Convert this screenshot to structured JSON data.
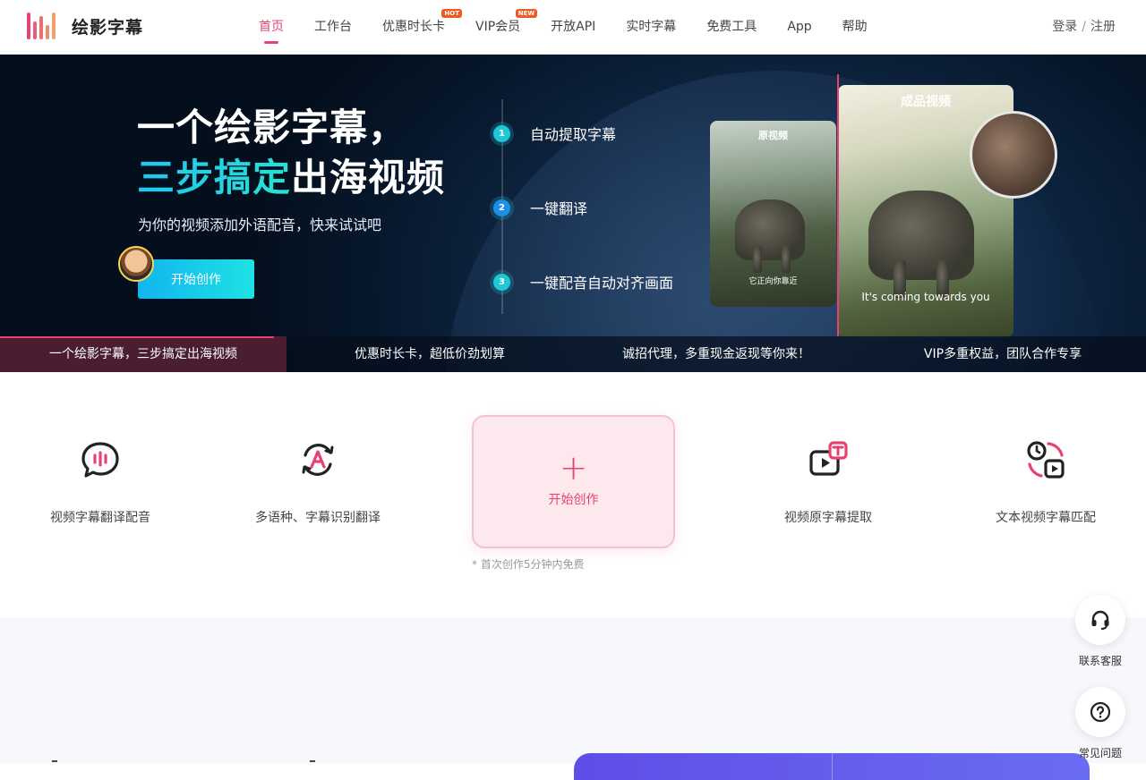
{
  "header": {
    "logo_text": "绘影字幕",
    "nav": [
      {
        "label": "首页",
        "active": true,
        "badge": ""
      },
      {
        "label": "工作台",
        "active": false,
        "badge": ""
      },
      {
        "label": "优惠时长卡",
        "active": false,
        "badge": "HOT"
      },
      {
        "label": "VIP会员",
        "active": false,
        "badge": "NEW"
      },
      {
        "label": "开放API",
        "active": false,
        "badge": ""
      },
      {
        "label": "实时字幕",
        "active": false,
        "badge": ""
      },
      {
        "label": "免费工具",
        "active": false,
        "badge": ""
      },
      {
        "label": "App",
        "active": false,
        "badge": ""
      },
      {
        "label": "帮助",
        "active": false,
        "badge": ""
      }
    ],
    "login": "登录",
    "login_sep": "/",
    "register": "注册"
  },
  "hero": {
    "title_line1": "一个绘影字幕，",
    "title_line2_highlight": "三步搞定",
    "title_line2_rest": "出海视频",
    "subtitle": "为你的视频添加外语配音，快来试试吧",
    "cta": "开始创作",
    "steps": [
      {
        "num": "1",
        "label": "自动提取字幕",
        "color": "#1ec8d6"
      },
      {
        "num": "2",
        "label": "一键翻译",
        "color": "#1e8ee8"
      },
      {
        "num": "3",
        "label": "一键配音自动对齐画面",
        "color": "#1ec8d6"
      }
    ],
    "original_card": {
      "title": "原视频",
      "caption": "它正向你靠近"
    },
    "final_card": {
      "title": "成品视频",
      "caption": "It's coming towards you"
    },
    "tabs": [
      {
        "label": "一个绘影字幕，三步搞定出海视频",
        "active": true
      },
      {
        "label": "优惠时长卡，超低价劲划算",
        "active": false
      },
      {
        "label": "诚招代理，多重现金返现等你来！",
        "active": false
      },
      {
        "label": "VIP多重权益，团队合作专享",
        "active": false
      }
    ]
  },
  "features": {
    "items": [
      {
        "label": "视频字幕翻译配音",
        "icon": "speech-bubble-icon"
      },
      {
        "label": "多语种、字幕识别翻译",
        "icon": "translate-cycle-icon"
      },
      {
        "label": "视频原字幕提取",
        "icon": "video-text-icon"
      },
      {
        "label": "文本视频字幕匹配",
        "icon": "clock-video-icon"
      }
    ],
    "create": {
      "plus": "+",
      "label": "开始创作"
    },
    "free_note": "* 首次创作5分钟内免费"
  },
  "floating": {
    "service_label": "联系客服",
    "faq_label": "常见问题"
  },
  "colors": {
    "accent": "#e8436f",
    "cyan": "#1fe1e4"
  }
}
